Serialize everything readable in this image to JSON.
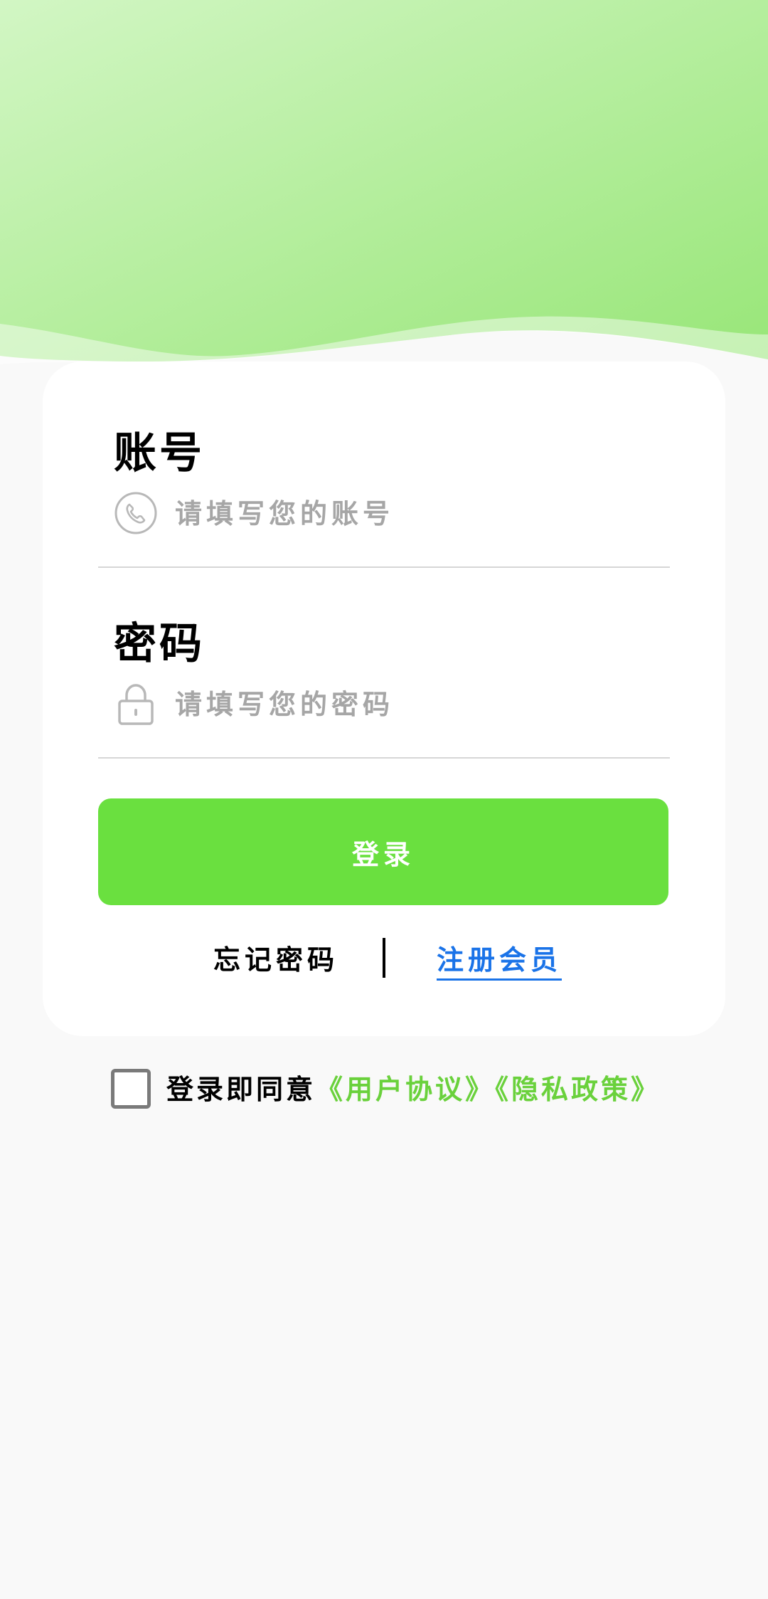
{
  "colors": {
    "accent": "#6ae03f",
    "link_blue": "#1a73e8",
    "link_green": "#6ad13c",
    "header_light": "#d2f6c4",
    "header_dark": "#98e678"
  },
  "form": {
    "account_label": "账号",
    "account_placeholder": "请填写您的账号",
    "account_icon": "phone-icon",
    "password_label": "密码",
    "password_placeholder": "请填写您的密码",
    "password_icon": "lock-icon",
    "login_label": "登录"
  },
  "links": {
    "forgot": "忘记密码",
    "register": "注册会员"
  },
  "agreement": {
    "prefix": "登录即同意",
    "user_agreement": "《用户协议》",
    "privacy_policy": "《隐私政策》"
  }
}
